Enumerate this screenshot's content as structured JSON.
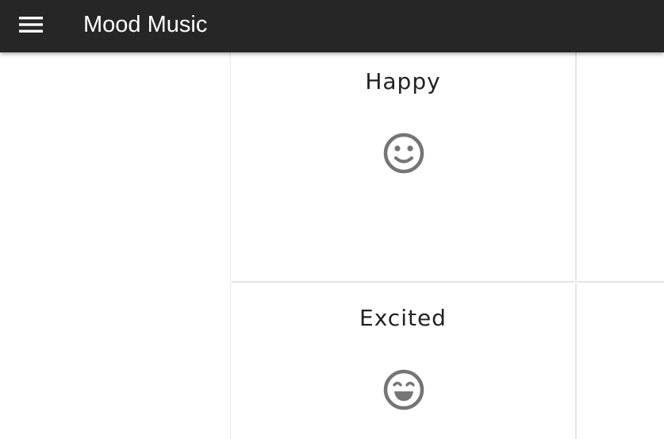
{
  "app_bar": {
    "title": "Mood Music",
    "menu_icon": "hamburger-menu-icon",
    "background": "#262626"
  },
  "moods": [
    {
      "label": "Happy",
      "icon": "smiley-face-icon"
    },
    {
      "label": "Excited",
      "icon": "grinning-face-icon"
    }
  ],
  "colors": {
    "icon": "#757575",
    "card_title": "#222222"
  }
}
